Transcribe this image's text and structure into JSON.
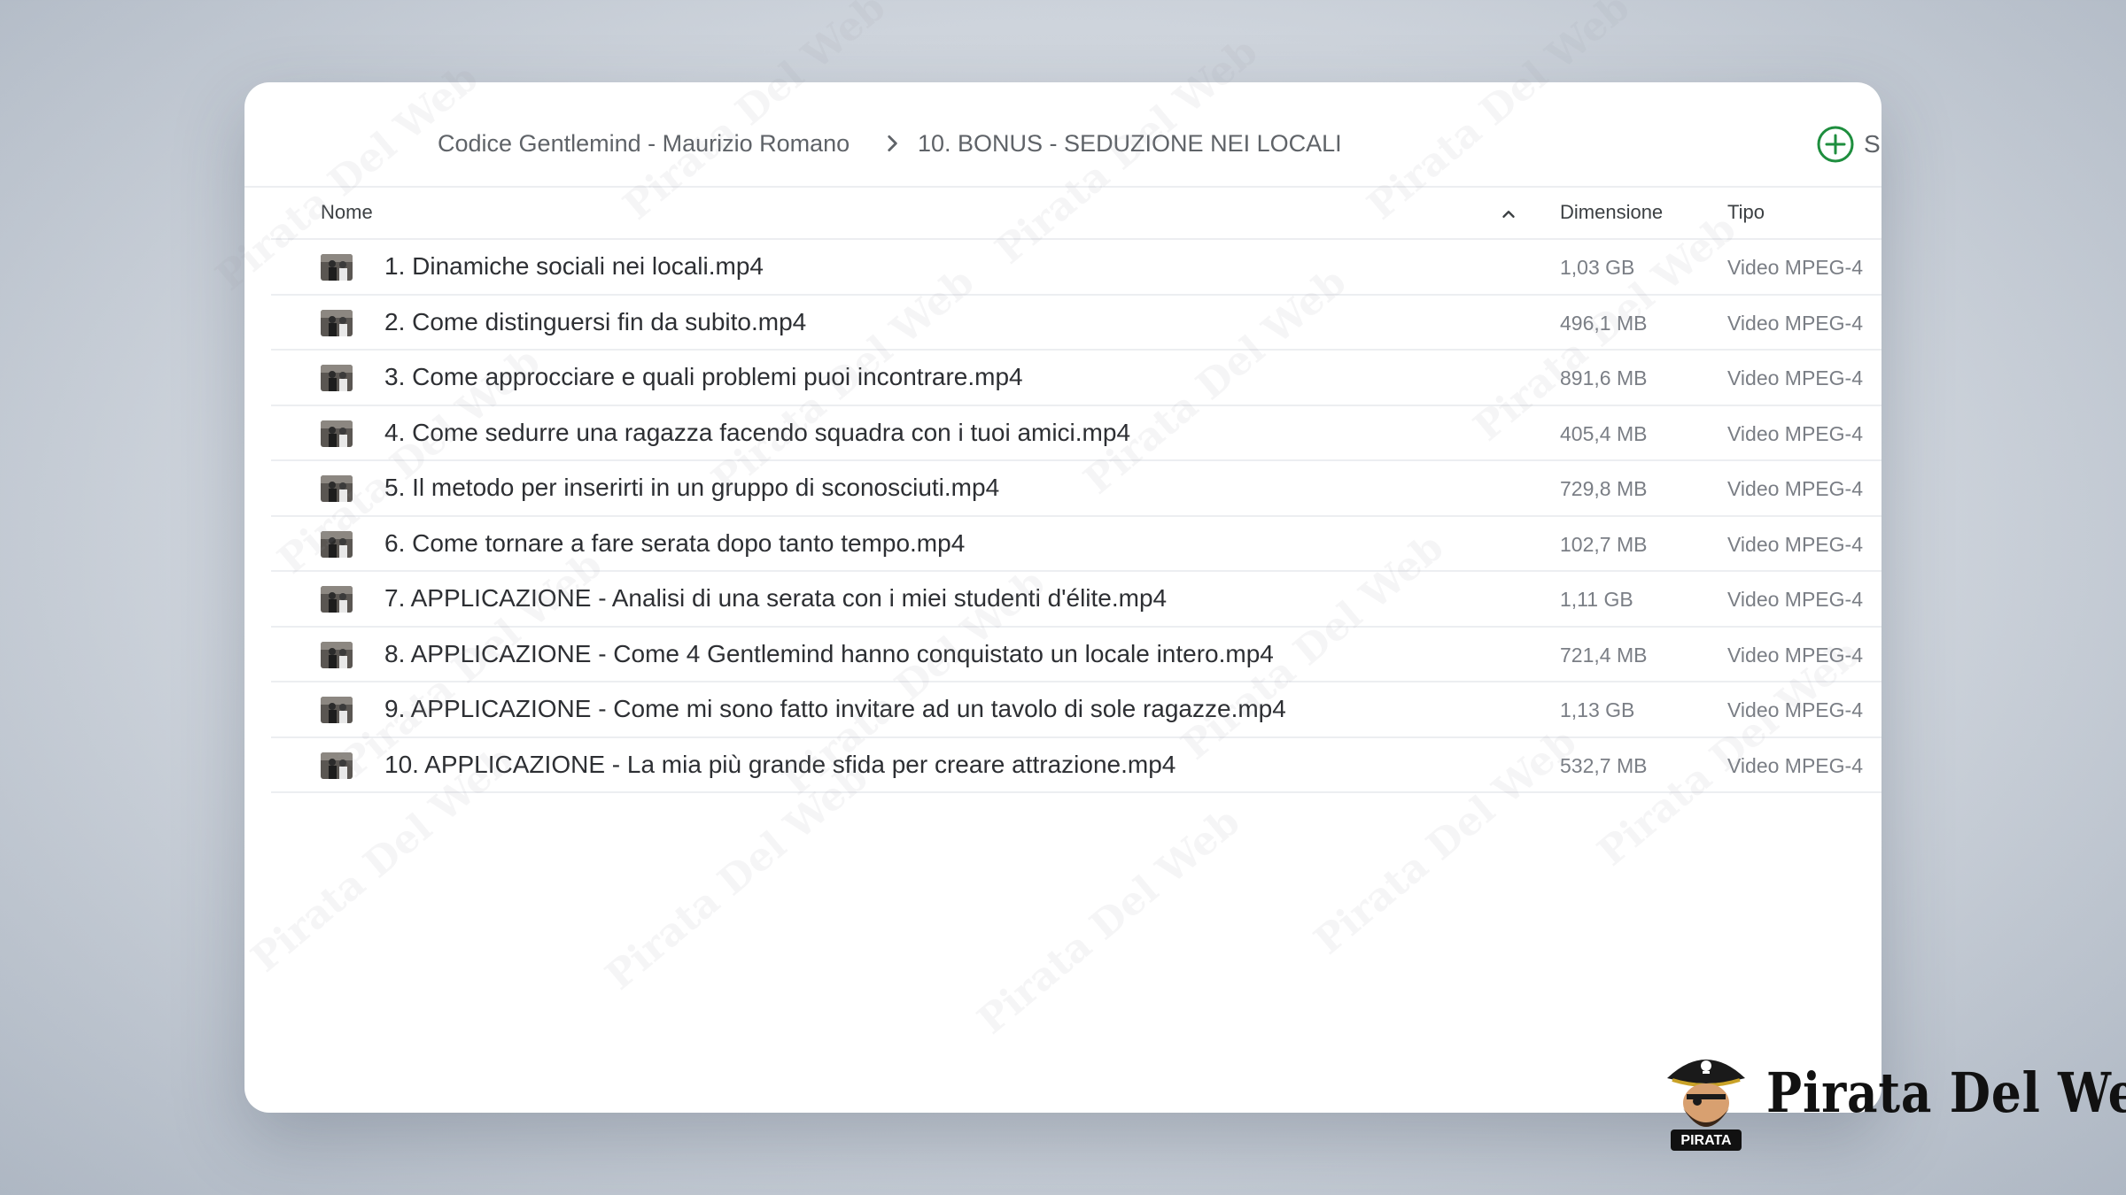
{
  "breadcrumb": {
    "root": "Codice Gentlemind - Maurizio Romano",
    "current": "10. BONUS - SEDUZIONE NEI LOCALI"
  },
  "new_button": {
    "label": "S",
    "icon": "plus-circle-icon",
    "color": "#1e8e3e"
  },
  "columns": {
    "name": "Nome",
    "size": "Dimensione",
    "type": "Tipo"
  },
  "files": [
    {
      "name": "1. Dinamiche sociali nei locali.mp4",
      "size": "1,03 GB",
      "type": "Video MPEG-4"
    },
    {
      "name": "2. Come distinguersi fin da subito.mp4",
      "size": "496,1 MB",
      "type": "Video MPEG-4"
    },
    {
      "name": "3. Come approcciare e quali problemi puoi incontrare.mp4",
      "size": "891,6 MB",
      "type": "Video MPEG-4"
    },
    {
      "name": "4. Come sedurre una ragazza facendo squadra con i tuoi amici.mp4",
      "size": "405,4 MB",
      "type": "Video MPEG-4"
    },
    {
      "name": "5. Il metodo per inserirti in un gruppo di sconosciuti.mp4",
      "size": "729,8 MB",
      "type": "Video MPEG-4"
    },
    {
      "name": "6. Come tornare a fare serata dopo tanto tempo.mp4",
      "size": "102,7 MB",
      "type": "Video MPEG-4"
    },
    {
      "name": "7. APPLICAZIONE - Analisi di una serata con i miei studenti d'élite.mp4",
      "size": "1,11 GB",
      "type": "Video MPEG-4"
    },
    {
      "name": "8. APPLICAZIONE - Come 4 Gentlemind hanno conquistato un locale intero.mp4",
      "size": "721,4 MB",
      "type": "Video MPEG-4"
    },
    {
      "name": "9. APPLICAZIONE - Come mi sono fatto invitare ad un tavolo di sole ragazze.mp4",
      "size": "1,13 GB",
      "type": "Video MPEG-4"
    },
    {
      "name": "10. APPLICAZIONE - La mia più grande sfida per creare attrazione.mp4",
      "size": "532,7 MB",
      "type": "Video MPEG-4"
    }
  ],
  "watermark": {
    "text": "Pirata Del Web"
  },
  "brand": {
    "name": "Pirata Del Web",
    "badge": "PIRATA"
  }
}
